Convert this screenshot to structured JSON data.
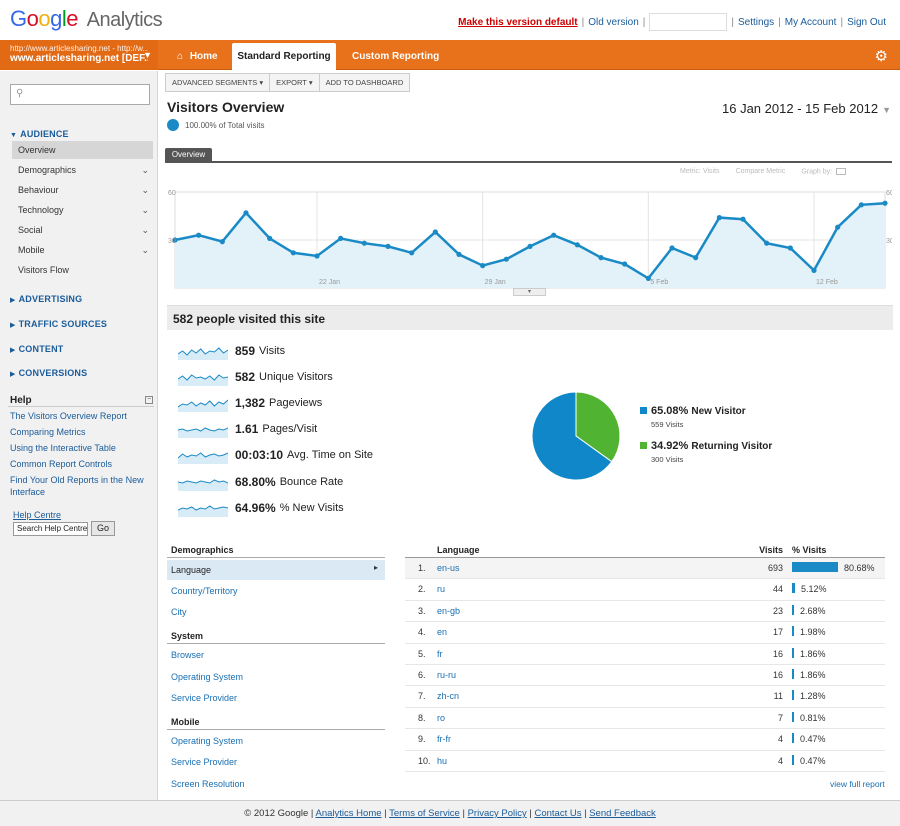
{
  "brand": {
    "google": "Google",
    "analytics": "Analytics"
  },
  "toplinks": {
    "make_default": "Make this version default",
    "old_version": "Old version",
    "settings": "Settings",
    "my_account": "My Account",
    "sign_out": "Sign Out"
  },
  "account": {
    "url": "http://www.articlesharing.net - http://w...",
    "name": "www.articlesharing.net [DEF..."
  },
  "nav": {
    "home": "Home",
    "standard": "Standard Reporting",
    "custom": "Custom Reporting"
  },
  "sidebar": {
    "search_placeholder": "",
    "audience": "AUDIENCE",
    "items": [
      {
        "label": "Overview",
        "chev": false
      },
      {
        "label": "Demographics",
        "chev": true
      },
      {
        "label": "Behaviour",
        "chev": true
      },
      {
        "label": "Technology",
        "chev": true
      },
      {
        "label": "Social",
        "chev": true
      },
      {
        "label": "Mobile",
        "chev": true
      },
      {
        "label": "Visitors Flow",
        "chev": false
      }
    ],
    "sections": [
      "ADVERTISING",
      "TRAFFIC SOURCES",
      "CONTENT",
      "CONVERSIONS"
    ],
    "help_title": "Help",
    "help_links": [
      "The Visitors Overview Report",
      "Comparing Metrics",
      "Using the Interactive Table",
      "Common Report Controls",
      "Find Your Old Reports in the New Interface"
    ],
    "help_centre": "Help Centre",
    "help_search_value": "Search Help Centre",
    "go": "Go"
  },
  "toolbar": {
    "advanced_segments": "ADVANCED SEGMENTS",
    "export": "EXPORT",
    "add_dashboard": "ADD TO DASHBOARD"
  },
  "report": {
    "title": "Visitors Overview",
    "total": "100.00% of Total visits",
    "date_start": "16 Jan 2012",
    "date_sep": " - ",
    "date_end": "15 Feb 2012",
    "tab": "Overview",
    "metric_label": "Metric:",
    "metric_value": "Visits",
    "compare": "Compare Metric",
    "graph_by": "Graph by:"
  },
  "chart_data": {
    "type": "line",
    "series": [
      {
        "values": [
          30,
          33,
          29,
          47,
          31,
          22,
          20,
          31,
          28,
          26,
          22,
          35,
          21,
          14,
          18,
          26,
          33,
          27,
          19,
          15,
          6,
          25,
          19,
          44,
          43,
          28,
          25,
          11,
          38,
          52,
          53
        ]
      }
    ],
    "x_tick_labels": [
      "22 Jan",
      "29 Jan",
      "5 Feb",
      "12 Feb"
    ],
    "y_tick_labels": [
      "60",
      "30"
    ],
    "ylim": [
      0,
      60
    ]
  },
  "summary": {
    "headline": "582 people visited this site"
  },
  "metrics": [
    {
      "value": "859",
      "label": "Visits"
    },
    {
      "value": "582",
      "label": "Unique Visitors"
    },
    {
      "value": "1,382",
      "label": "Pageviews"
    },
    {
      "value": "1.61",
      "label": "Pages/Visit"
    },
    {
      "value": "00:03:10",
      "label": "Avg. Time on Site"
    },
    {
      "value": "68.80%",
      "label": "Bounce Rate"
    },
    {
      "value": "64.96%",
      "label": "% New Visits"
    }
  ],
  "pie": {
    "slices": [
      {
        "pct": "65.08%",
        "name": "New Visitor",
        "sub": "559 Visits",
        "value": 65.08,
        "color": "#0f87c8"
      },
      {
        "pct": "34.92%",
        "name": "Returning Visitor",
        "sub": "300 Visits",
        "value": 34.92,
        "color": "#50b432"
      }
    ]
  },
  "demographics": {
    "head": "Demographics",
    "language": "Language",
    "country": "Country/Territory",
    "city": "City",
    "system_head": "System",
    "browser": "Browser",
    "os": "Operating System",
    "sp": "Service Provider",
    "mobile_head": "Mobile",
    "m_os": "Operating System",
    "m_sp": "Service Provider",
    "m_res": "Screen Resolution"
  },
  "language_table": {
    "col_language": "Language",
    "col_visits": "Visits",
    "col_pct": "% Visits",
    "rows": [
      {
        "n": "1.",
        "lang": "en-us",
        "visits": "693",
        "pct": "80.68%",
        "frac": 0.8068
      },
      {
        "n": "2.",
        "lang": "ru",
        "visits": "44",
        "pct": "5.12%",
        "frac": 0.0512
      },
      {
        "n": "3.",
        "lang": "en-gb",
        "visits": "23",
        "pct": "2.68%",
        "frac": 0.0268
      },
      {
        "n": "4.",
        "lang": "en",
        "visits": "17",
        "pct": "1.98%",
        "frac": 0.0198
      },
      {
        "n": "5.",
        "lang": "fr",
        "visits": "16",
        "pct": "1.86%",
        "frac": 0.0186
      },
      {
        "n": "6.",
        "lang": "ru-ru",
        "visits": "16",
        "pct": "1.86%",
        "frac": 0.0186
      },
      {
        "n": "7.",
        "lang": "zh-cn",
        "visits": "11",
        "pct": "1.28%",
        "frac": 0.0128
      },
      {
        "n": "8.",
        "lang": "ro",
        "visits": "7",
        "pct": "0.81%",
        "frac": 0.0081
      },
      {
        "n": "9.",
        "lang": "fr-fr",
        "visits": "4",
        "pct": "0.47%",
        "frac": 0.0047
      },
      {
        "n": "10.",
        "lang": "hu",
        "visits": "4",
        "pct": "0.47%",
        "frac": 0.0047
      }
    ],
    "view_full": "view full report"
  },
  "footer": {
    "copyright": "© 2012 Google",
    "home": "Analytics Home",
    "terms": "Terms of Service",
    "privacy": "Privacy Policy",
    "contact": "Contact Us",
    "feedback": "Send Feedback"
  },
  "colors": {
    "orange": "#e8711c",
    "blue": "#0f87c8",
    "green": "#50b432"
  }
}
